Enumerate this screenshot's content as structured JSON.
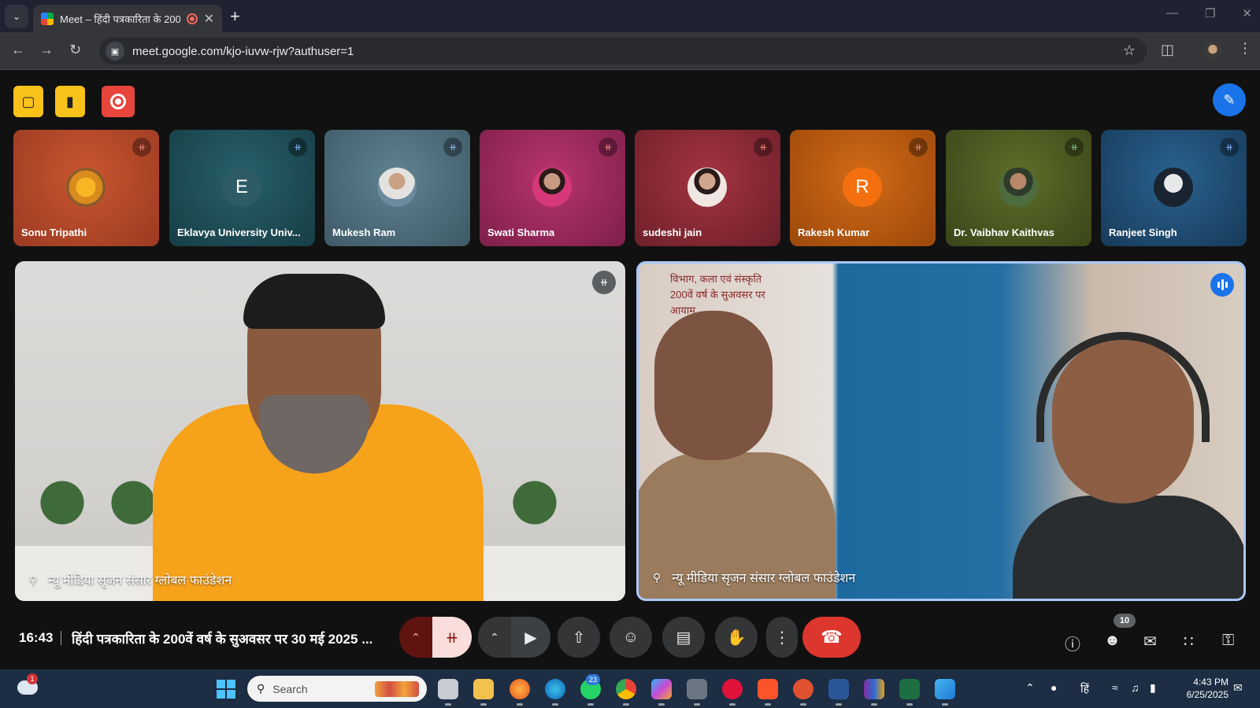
{
  "browser": {
    "tab_title": "Meet – हिंदी पत्रकारिता के 200",
    "url": "meet.google.com/kjo-iuvw-rjw?authuser=1",
    "tab_search_icon": "chevron-down-icon",
    "new_tab_icon": "plus-icon"
  },
  "participants": [
    {
      "name": "Sonu Tripathi",
      "mic": "muted",
      "avatar": "sunflower",
      "bg": "#b6452a"
    },
    {
      "name": "Eklavya University Univ...",
      "mic": "muted-blue",
      "avatar_letter": "E",
      "bg": "#1f4f57"
    },
    {
      "name": "Mukesh Ram",
      "mic": "muted-blue",
      "avatar": "photo",
      "bg": "#4e6e7d"
    },
    {
      "name": "Swati Sharma",
      "mic": "muted",
      "avatar": "photo",
      "bg": "#9b2a5f"
    },
    {
      "name": "sudeshi jain",
      "mic": "muted",
      "avatar": "photo",
      "bg": "#8a2b35"
    },
    {
      "name": "Rakesh Kumar",
      "mic": "muted",
      "avatar_letter": "R",
      "bg": "#b35a12"
    },
    {
      "name": "Dr. Vaibhav Kaithvas",
      "mic": "muted-green",
      "avatar": "photo",
      "bg": "#4f5d24"
    },
    {
      "name": "Ranjeet Singh",
      "mic": "muted-blue",
      "avatar": "photo",
      "bg": "#1f4f79"
    }
  ],
  "tiles": {
    "left_label": "न्यू मीडिया सृजन संसार ग्लोबल फाउंडेशन",
    "right_label": "न्यू मीडिया सृजन संसार ग्लोबल फाउंडेशन",
    "right_banner": "...विभाग, कला एवं संस्कृति\n...200वें वर्ष के सुअवसर पर\nआयाम"
  },
  "bottom": {
    "time": "16:43",
    "meeting_title": "हिंदी पत्रकारिता के 200वें वर्ष के सुअवसर पर 30 मई 2025 ...",
    "participant_count": "10"
  },
  "taskbar": {
    "search_placeholder": "Search",
    "weather_badge": "1",
    "whatsapp_badge": "23",
    "clock_time": "4:43 PM",
    "clock_date": "6/25/2025"
  },
  "colors": {
    "meet_bg": "#111111",
    "end_call": "#dc362e",
    "active_speaker_border": "#a8c7fa",
    "accent_blue": "#1a73e8"
  }
}
